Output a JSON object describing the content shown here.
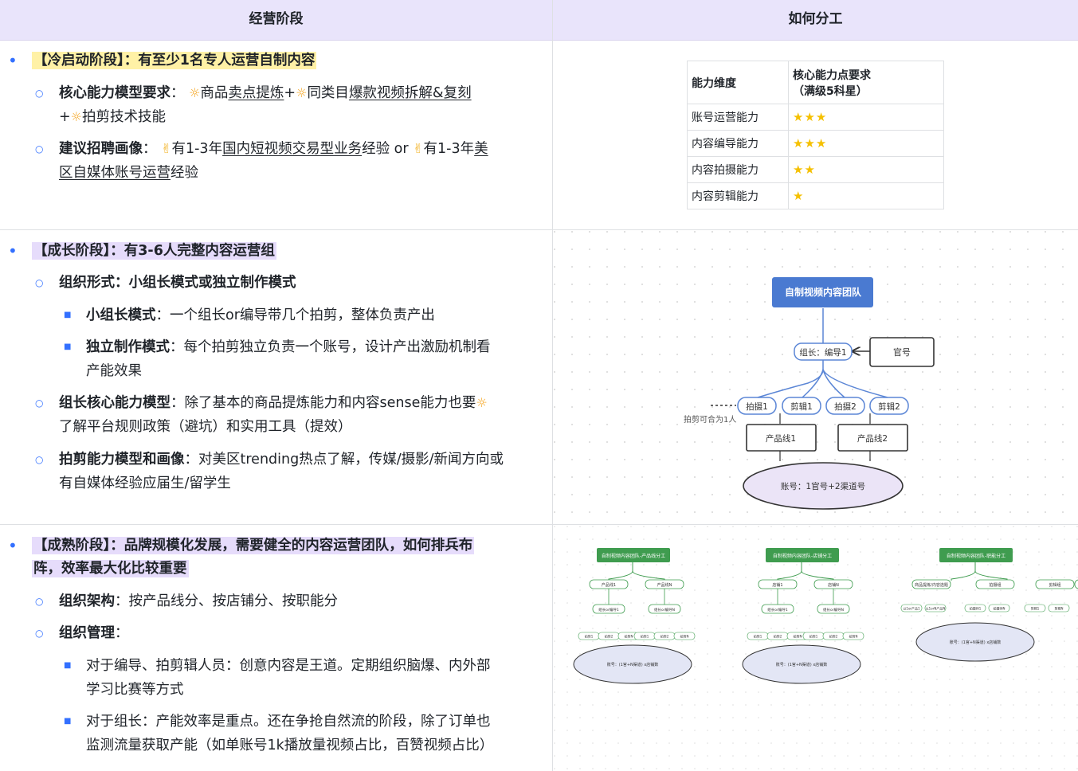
{
  "header": {
    "col1": "经营阶段",
    "col2": "如何分工"
  },
  "stage1": {
    "title": "【冷启动阶段】：有至少1名专人运营自制内容",
    "ability_label": "核心能力模型要求",
    "ability_line1_a": "商品",
    "ability_line1_b": "卖点提炼",
    "ability_line1_c": "+",
    "ability_line1_d": "同类目",
    "ability_line1_e": "爆款视频拆解&复刻",
    "ability_line2": "拍剪技术技能",
    "recruit_label": "建议招聘画像",
    "recruit_line1_a": "有1-3年",
    "recruit_line1_b": "国内短视频交易型业务",
    "recruit_line1_c": "经验 or",
    "recruit_line1_d": "有1-3年",
    "recruit_line1_e": "美",
    "recruit_line2_a": "区自媒体账号运营",
    "recruit_line2_b": "经验"
  },
  "ability_table": {
    "header_dim": "能力维度",
    "header_req1": "核心能力点要求",
    "header_req2": "（满级5科星）",
    "rows": [
      {
        "name": "账号运营能力",
        "stars": "★★★"
      },
      {
        "name": "内容编导能力",
        "stars": "★★★"
      },
      {
        "name": "内容拍摄能力",
        "stars": "★★"
      },
      {
        "name": "内容剪辑能力",
        "stars": "★"
      }
    ]
  },
  "stage2": {
    "title": "【成长阶段】：有3-6人完整内容运营组",
    "org_form": "组织形式：小组长模式或独立制作模式",
    "leader_mode_label": "小组长模式",
    "leader_mode_text": "：一个组长or编导带几个拍剪，整体负责产出",
    "indep_label": "独立制作模式",
    "indep_text1": "：每个拍剪独立负责一个账号，设计产出激励机制看",
    "indep_text2": "产能效果",
    "leader_core_label": "组长核心能力模型",
    "leader_core_text1": "：除了基本的商品提炼能力和内容sense能力也要",
    "leader_core_text2": "了解平台规则政策（避坑）和实用工具（提效）",
    "editor_label": "拍剪能力模型和画像",
    "editor_text1": "：对美区trending热点了解，传媒/摄影/新闻方向或",
    "editor_text2": "有自媒体经验应届生/留学生"
  },
  "org_chart": {
    "team": "自制视频内容团队",
    "leader": "组长：编导1",
    "official": "官号",
    "members": [
      "拍摄1",
      "剪辑1",
      "拍摄2",
      "剪辑2"
    ],
    "note": "拍剪可合为1人",
    "lines": [
      "产品线1",
      "产品线2"
    ],
    "accounts": "账号：1官号+2渠道号"
  },
  "stage3": {
    "title1": "【成熟阶段】：品牌规模化发展，需要健全的内容运营团队，如何排兵布",
    "title2": "阵，效率最大化比较重要",
    "arch_label": "组织架构",
    "arch_text": "：按产品线分、按店铺分、按职能分",
    "mgmt_label": "组织管理",
    "mgmt_colon": "：",
    "mgmt1_line1": "对于编导、拍剪辑人员：创意内容是王道。定期组织脑爆、内外部",
    "mgmt1_line2": "学习比赛等方式",
    "mgmt2_line1": "对于组长：产能效率是重点。还在争抢自然流的阶段，除了订单也",
    "mgmt2_line2": "监测流量获取产能（如单账号1k播放量视频占比，百赞视频占比）"
  },
  "mini_charts": [
    {
      "title": "自制视频内容团队-产品线分工",
      "l1a": "产品线1",
      "l1b": "产品线N",
      "l2a": "组长or编导1",
      "l2b": "组长or编导N",
      "leaf": [
        "拍剪1",
        "拍剪2",
        "拍剪N",
        "拍剪1",
        "拍剪2",
        "拍剪N"
      ],
      "account": "账号：(1官+N渠道) x店铺数"
    },
    {
      "title": "自制视频内容团队-店铺分工",
      "l1a": "店铺1",
      "l1b": "店铺N",
      "l2a": "组长or编导1",
      "l2b": "组长or编导N",
      "leaf": [
        "拍剪1",
        "拍剪2",
        "拍剪N",
        "拍剪1",
        "拍剪2",
        "拍剪N"
      ],
      "account": "账号：(1官+N渠道) x店铺数"
    },
    {
      "title": "自制视频内容团队-职能分工",
      "l1a": "商品提炼/内容选题",
      "l1b": "拍摄组",
      "l2a": "剪辑组",
      "l2b": "运营",
      "leaf": [
        "以1or产品1",
        "以1orN产品N",
        "拍摄师1",
        "拍摄师N",
        "剪辑1",
        "剪辑N"
      ],
      "account": "账号：(1官+N渠道) x店铺数"
    }
  ]
}
